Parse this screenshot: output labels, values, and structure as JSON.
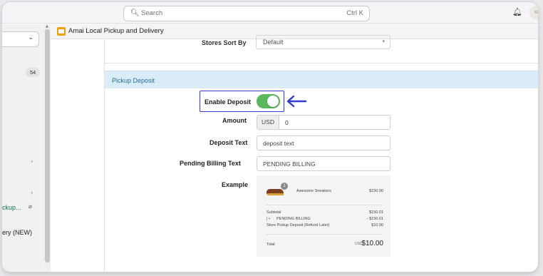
{
  "topbar": {
    "search_placeholder": "Search",
    "search_shortcut": "Ctrl K",
    "avatar_initials": "KI"
  },
  "sidebar": {
    "badge_count": "54",
    "item_pickup": "ckup...",
    "item_delivery": "ery (NEW)"
  },
  "app": {
    "title": "Amai Local Pickup and Delivery"
  },
  "store_sort": {
    "label": "Stores Sort By",
    "value": "Default"
  },
  "pickup_deposit": {
    "section_title": "Pickup Deposit",
    "enable_label": "Enable Deposit",
    "enabled": true,
    "amount_label": "Amount",
    "amount_currency": "USD",
    "amount_value": "0",
    "deposit_text_label": "Deposit Text",
    "deposit_text_value": "deposit text",
    "pending_label": "Pending Billing Text",
    "pending_value": "PENDING BILLING",
    "example_label": "Example"
  },
  "example": {
    "qty": "1",
    "product_name": "Awesome Sneakers",
    "product_price": "$150.00",
    "subtotal_label": "Subtotal",
    "subtotal_value": "$150.01",
    "pending_label": "PENDING BILLING",
    "pending_value": "- $150.01",
    "deposit_label": "Store Pickup Deposit (Refund Later)",
    "deposit_value": "$10.00",
    "total_label": "Total",
    "total_currency": "USD",
    "total_value": "$10.00"
  },
  "colors": {
    "toggle_on": "#5cb85c",
    "highlight": "#2f3dd1",
    "section_header_bg": "#d9ecf7"
  }
}
